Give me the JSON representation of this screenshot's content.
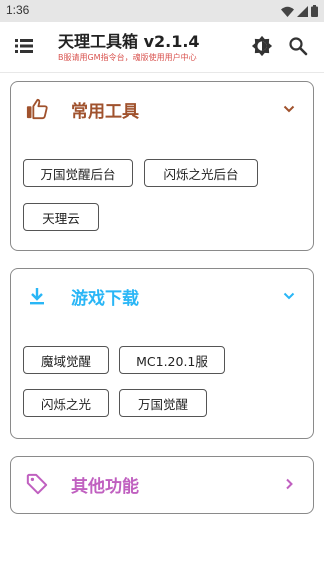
{
  "status_bar": {
    "time": "1:36"
  },
  "header": {
    "title": "天理工具箱 v2.1.4",
    "subtitle": "B服请用GM指令台，魂版使用用户中心"
  },
  "sections": [
    {
      "title": "常用工具",
      "icon": "thumbs-up-icon",
      "expanded": true,
      "color": "#a0522d",
      "items": [
        "万国觉醒后台",
        "闪烁之光后台",
        "天理云"
      ]
    },
    {
      "title": "游戏下载",
      "icon": "download-icon",
      "expanded": true,
      "color": "#29b6f6",
      "items": [
        "魔域觉醒",
        "MC1.20.1服",
        "闪烁之光",
        "万国觉醒"
      ]
    },
    {
      "title": "其他功能",
      "icon": "tag-icon",
      "expanded": false,
      "color": "#c060c0",
      "items": []
    }
  ]
}
